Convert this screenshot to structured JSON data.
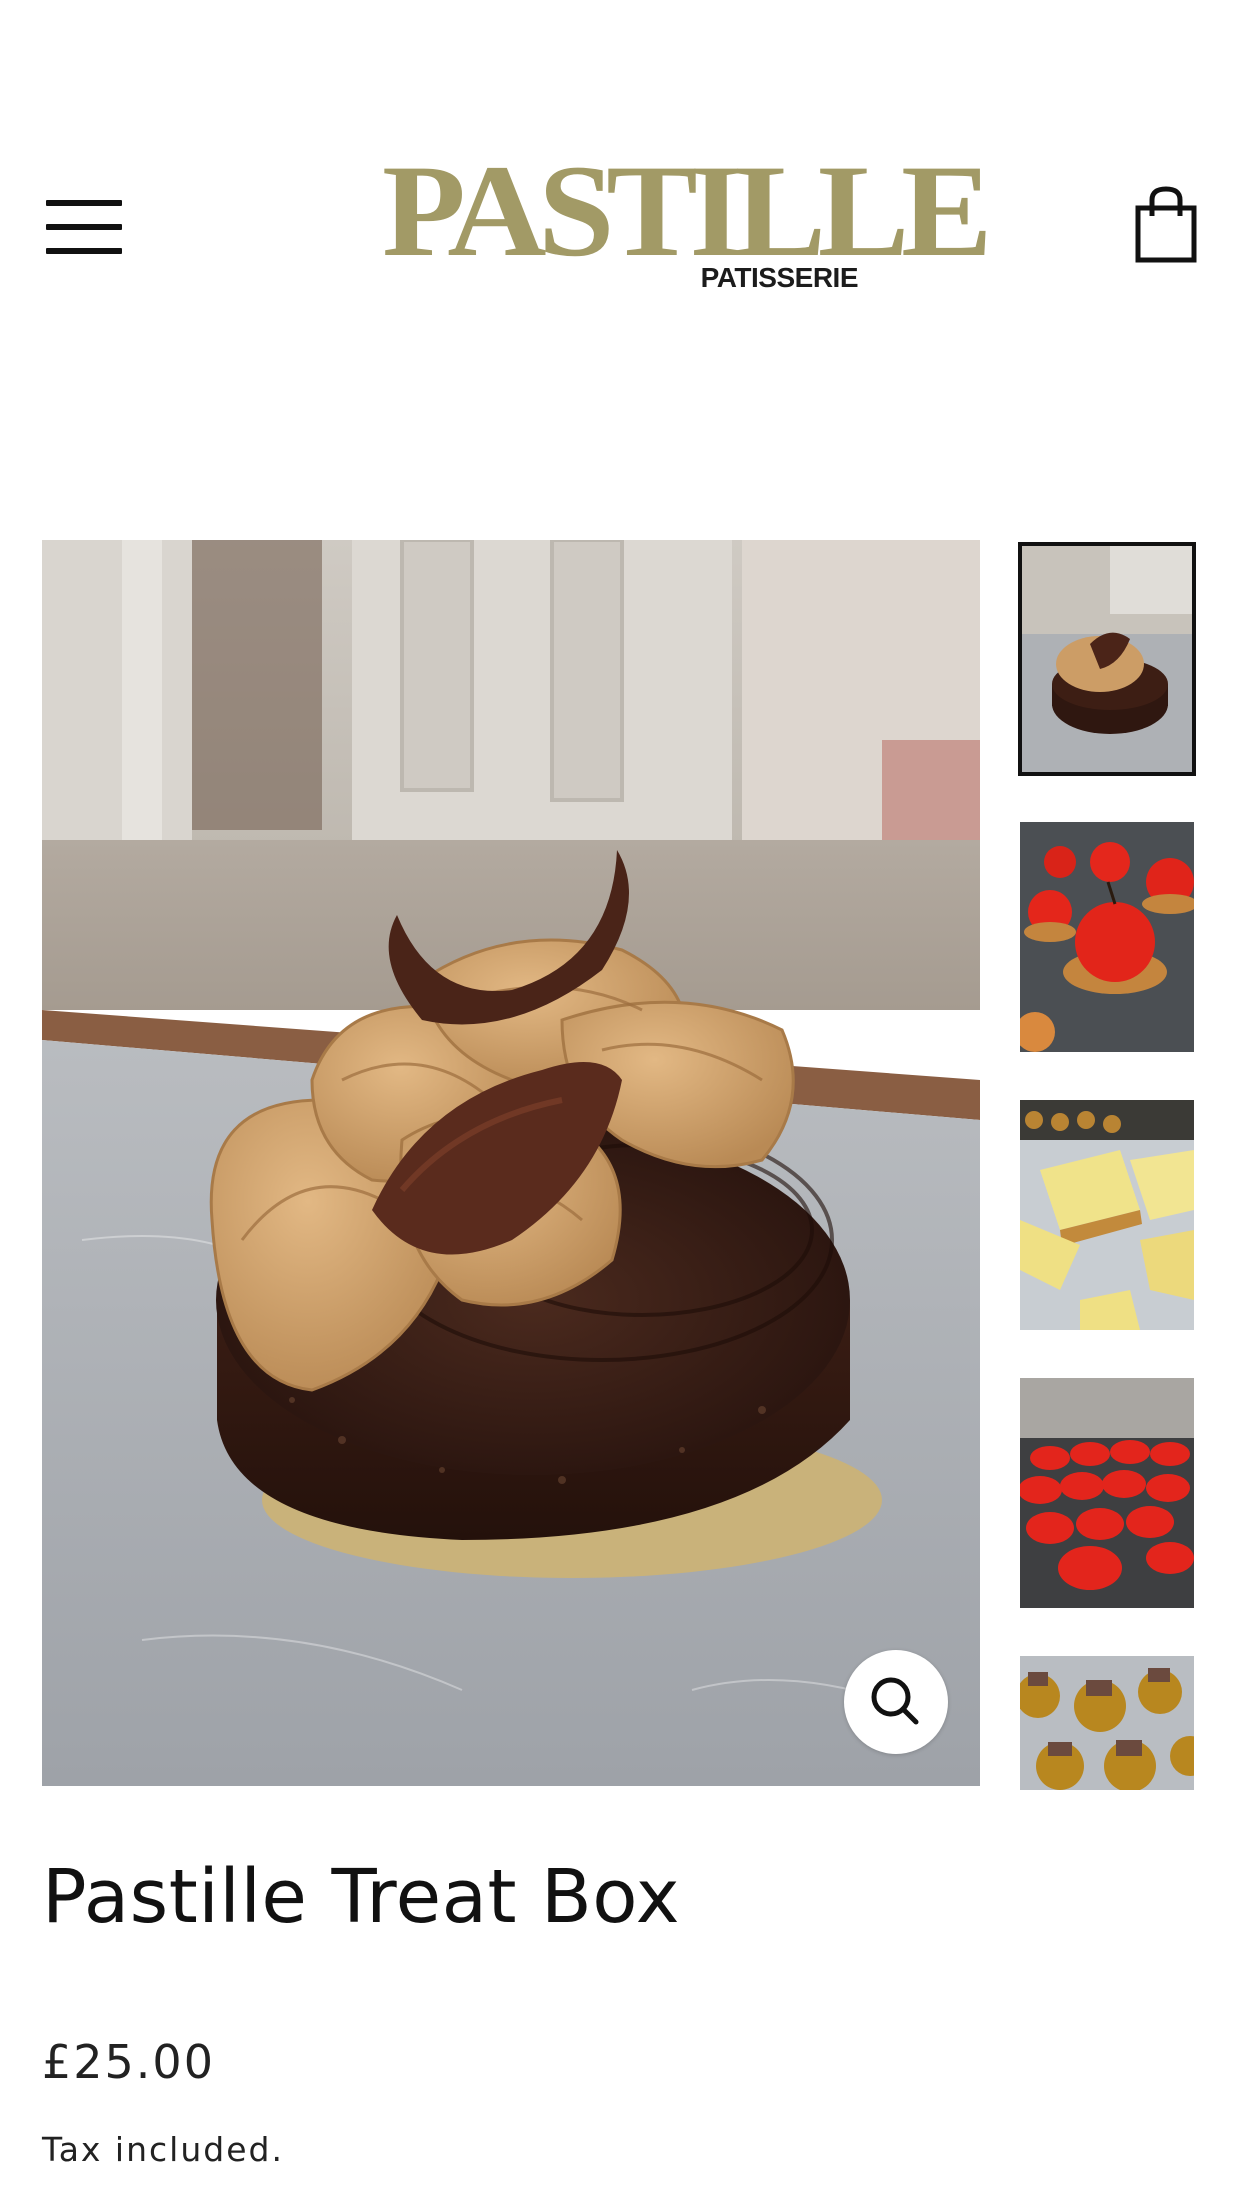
{
  "header": {
    "logo_main": "PASTILLE",
    "logo_sub": "PATISSERIE",
    "menu_icon": "hamburger-menu-icon",
    "cart_icon": "shopping-bag-icon"
  },
  "gallery": {
    "zoom_icon": "magnifier-icon",
    "thumbnails": [
      {
        "subject": "chocolate caramel cake",
        "active": true
      },
      {
        "subject": "red cherry tarts",
        "active": false
      },
      {
        "subject": "custard tart slices",
        "active": false
      },
      {
        "subject": "red macarons",
        "active": false
      },
      {
        "subject": "chocolate domes",
        "active": false
      }
    ]
  },
  "product": {
    "title": "Pastille Treat Box",
    "price": "£25.00",
    "tax_note": "Tax included."
  },
  "colors": {
    "brand": "#a29a66",
    "text": "#111111",
    "background": "#ffffff"
  }
}
